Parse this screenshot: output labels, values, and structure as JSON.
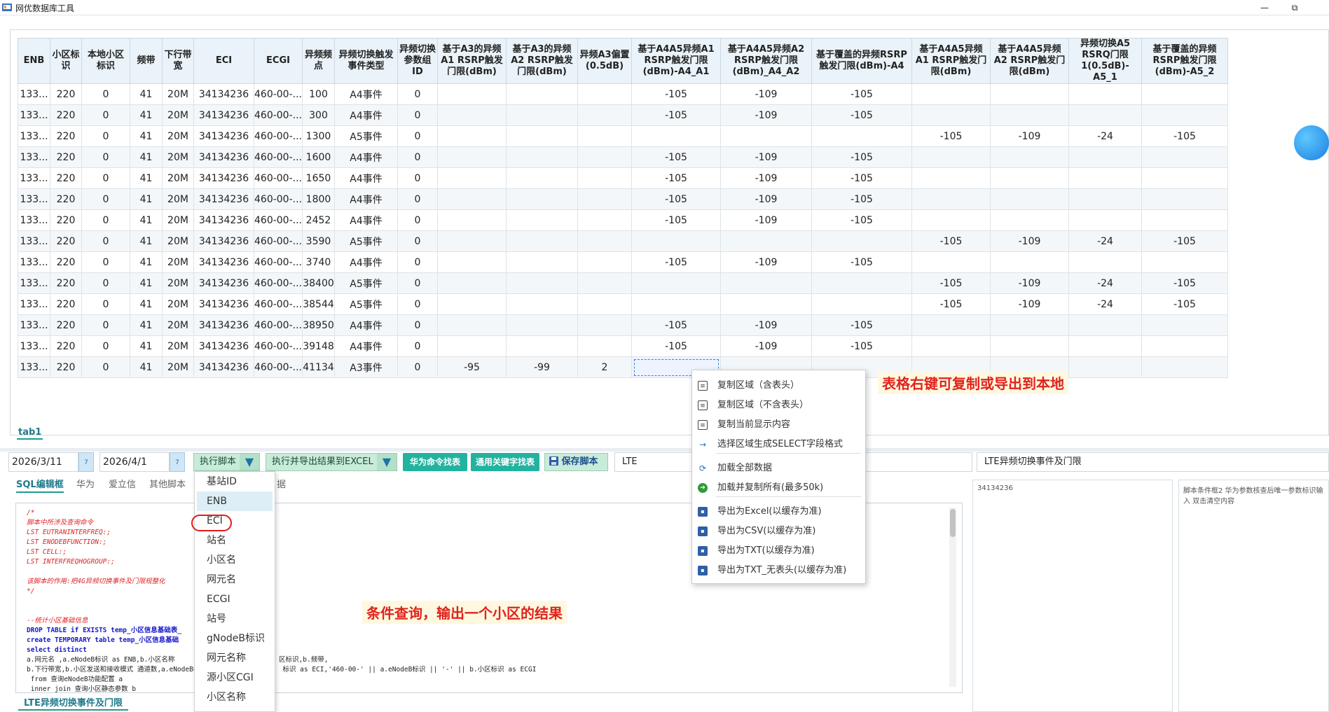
{
  "app": {
    "title": "网优数据库工具",
    "min_glyph": "—",
    "restore_glyph": "⧉"
  },
  "grid": {
    "headers": [
      "ENB",
      "小区标识",
      "本地小区标识",
      "频带",
      "下行带宽",
      "ECI",
      "ECGI",
      "异频频点",
      "异频切换触发事件类型",
      "异频切换参数组ID",
      "基于A3的异频A1 RSRP触发门限(dBm)",
      "基于A3的异频A2 RSRP触发门限(dBm)",
      "异频A3偏置(0.5dB)",
      "基于A4A5异频A1 RSRP触发门限(dBm)-A4_A1",
      "基于A4A5异频A2 RSRP触发门限(dBm)_A4_A2",
      "基于覆盖的异频RSRP触发门限(dBm)-A4",
      "基于A4A5异频A1 RSRP触发门限(dBm)",
      "基于A4A5异频A2 RSRP触发门限(dBm)",
      "异频切换A5 RSRQ门限1(0.5dB)-A5_1",
      "基于覆盖的异频RSRP触发门限(dBm)-A5_2"
    ],
    "rows": [
      [
        "133...",
        "220",
        "0",
        "41",
        "20M",
        "34134236",
        "460-00-...",
        "100",
        "A4事件",
        "0",
        "",
        "",
        "",
        "-105",
        "-109",
        "-105",
        "",
        "",
        "",
        ""
      ],
      [
        "133...",
        "220",
        "0",
        "41",
        "20M",
        "34134236",
        "460-00-...",
        "300",
        "A4事件",
        "0",
        "",
        "",
        "",
        "-105",
        "-109",
        "-105",
        "",
        "",
        "",
        ""
      ],
      [
        "133...",
        "220",
        "0",
        "41",
        "20M",
        "34134236",
        "460-00-...",
        "1300",
        "A5事件",
        "0",
        "",
        "",
        "",
        "",
        "",
        "",
        "-105",
        "-109",
        "-24",
        "-105"
      ],
      [
        "133...",
        "220",
        "0",
        "41",
        "20M",
        "34134236",
        "460-00-...",
        "1600",
        "A4事件",
        "0",
        "",
        "",
        "",
        "-105",
        "-109",
        "-105",
        "",
        "",
        "",
        ""
      ],
      [
        "133...",
        "220",
        "0",
        "41",
        "20M",
        "34134236",
        "460-00-...",
        "1650",
        "A4事件",
        "0",
        "",
        "",
        "",
        "-105",
        "-109",
        "-105",
        "",
        "",
        "",
        ""
      ],
      [
        "133...",
        "220",
        "0",
        "41",
        "20M",
        "34134236",
        "460-00-...",
        "1800",
        "A4事件",
        "0",
        "",
        "",
        "",
        "-105",
        "-109",
        "-105",
        "",
        "",
        "",
        ""
      ],
      [
        "133...",
        "220",
        "0",
        "41",
        "20M",
        "34134236",
        "460-00-...",
        "2452",
        "A4事件",
        "0",
        "",
        "",
        "",
        "-105",
        "-109",
        "-105",
        "",
        "",
        "",
        ""
      ],
      [
        "133...",
        "220",
        "0",
        "41",
        "20M",
        "34134236",
        "460-00-...",
        "3590",
        "A5事件",
        "0",
        "",
        "",
        "",
        "",
        "",
        "",
        "-105",
        "-109",
        "-24",
        "-105"
      ],
      [
        "133...",
        "220",
        "0",
        "41",
        "20M",
        "34134236",
        "460-00-...",
        "3740",
        "A4事件",
        "0",
        "",
        "",
        "",
        "-105",
        "-109",
        "-105",
        "",
        "",
        "",
        ""
      ],
      [
        "133...",
        "220",
        "0",
        "41",
        "20M",
        "34134236",
        "460-00-...",
        "38400",
        "A5事件",
        "0",
        "",
        "",
        "",
        "",
        "",
        "",
        "-105",
        "-109",
        "-24",
        "-105"
      ],
      [
        "133...",
        "220",
        "0",
        "41",
        "20M",
        "34134236",
        "460-00-...",
        "38544",
        "A5事件",
        "0",
        "",
        "",
        "",
        "",
        "",
        "",
        "-105",
        "-109",
        "-24",
        "-105"
      ],
      [
        "133...",
        "220",
        "0",
        "41",
        "20M",
        "34134236",
        "460-00-...",
        "38950",
        "A4事件",
        "0",
        "",
        "",
        "",
        "-105",
        "-109",
        "-105",
        "",
        "",
        "",
        ""
      ],
      [
        "133...",
        "220",
        "0",
        "41",
        "20M",
        "34134236",
        "460-00-...",
        "39148",
        "A4事件",
        "0",
        "",
        "",
        "",
        "-105",
        "-109",
        "-105",
        "",
        "",
        "",
        ""
      ],
      [
        "133...",
        "220",
        "0",
        "41",
        "20M",
        "34134236",
        "460-00-...",
        "41134",
        "A3事件",
        "0",
        "-95",
        "-99",
        "2",
        "",
        "",
        "",
        "",
        "",
        "",
        ""
      ]
    ],
    "tab_label": "tab1"
  },
  "annotations": {
    "right_click": "表格右键可复制或导出到本地",
    "condition_query": "条件查询，输出一个小区的结果"
  },
  "toolbar": {
    "date_from": "2026/3/11",
    "date_to": "2026/4/1",
    "calendar_glyph": "7",
    "run_script": "执行脚本",
    "run_export": "执行并导出结果到EXCEL",
    "huawei_cmd": "华为命令找表",
    "keyword_find": "通用关键字找表",
    "save_script": "保存脚本",
    "search_value": "LTE",
    "script_name": "LTE异频切换事件及门限",
    "dropdown_arrow": "▼"
  },
  "editor_tabs": [
    "SQL编辑框",
    "华为",
    "爱立信",
    "其他脚本"
  ],
  "editor_tab_tail": "据",
  "editor": {
    "lines": [
      {
        "t": "/*",
        "s": "red"
      },
      {
        "t": "脚本中所涉及查询命令",
        "s": "red"
      },
      {
        "t": "LST EUTRANINTERFREQ:;",
        "s": "red"
      },
      {
        "t": "LST ENODEBFUNCTION:;",
        "s": "red"
      },
      {
        "t": "LST CELL:;",
        "s": "red"
      },
      {
        "t": "LST INTERFREQHOGROUP:;",
        "s": "red"
      },
      {
        "t": "",
        "s": ""
      },
      {
        "t": "该脚本的作用:把4G异频切换事件及门限规整化",
        "s": "red"
      },
      {
        "t": "*/",
        "s": "red"
      },
      {
        "t": "",
        "s": ""
      },
      {
        "t": "",
        "s": ""
      },
      {
        "t": "--统计小区基础信息",
        "s": "red"
      },
      {
        "t": "DROP TABLE if EXISTS temp_小区信息基础表_",
        "s": "mix"
      },
      {
        "t": "create TEMPORARY table temp_小区信息基础",
        "s": "mix"
      },
      {
        "t": "select distinct",
        "s": "blue"
      },
      {
        "t": "a.网元名 ,a.eNodeB标识 as ENB,b.小区名称                          区标识,b.频带,",
        "s": ""
      },
      {
        "t": "b.下行带宽,b.小区发送和接收模式 通道数,a.eNodeB标识 *                 标识 as ECI,'460-00-' || a.eNodeB标识 || '-' || b.小区标识 as ECGI",
        "s": ""
      },
      {
        "t": " from 查询eNodeB功能配置 a",
        "s": ""
      },
      {
        "t": " inner join 查询小区静态参数 b",
        "s": ""
      }
    ],
    "vscroll_glyph": ""
  },
  "side": {
    "eci_value": "34134236",
    "hint": "脚本条件框2  华为参数核查后唯一参数标识输入   双击清空内容"
  },
  "bottom_tab": "LTE异频切换事件及门限",
  "dropdown_items": [
    "基站ID",
    "ENB",
    "ECI",
    "站名",
    "小区名",
    "网元名",
    "ECGI",
    "站号",
    "gNodeB标识",
    "网元名称",
    "源小区CGI",
    "小区名称"
  ],
  "context_menu": [
    {
      "label": "复制区域（含表头）",
      "icon": "doc-icon",
      "glyph": "≡"
    },
    {
      "label": "复制区域（不含表头）",
      "icon": "doc-icon",
      "glyph": "≡"
    },
    {
      "label": "复制当前显示内容",
      "icon": "doc-icon",
      "glyph": "≡"
    },
    {
      "label": "选择区域生成SELECT字段格式",
      "icon": "arrow-right-icon",
      "glyph": "→"
    },
    {
      "label": "加载全部数据",
      "icon": "refresh-icon",
      "glyph": "⟳"
    },
    {
      "label": "加载并复制所有(最多50k)",
      "icon": "go-icon",
      "glyph": "➜"
    },
    {
      "label": "导出为Excel(以缓存为准)",
      "icon": "disk-icon",
      "glyph": "▪"
    },
    {
      "label": "导出为CSV(以缓存为准)",
      "icon": "disk-icon",
      "glyph": "▪"
    },
    {
      "label": "导出为TXT(以缓存为准)",
      "icon": "disk-icon",
      "glyph": "▪"
    },
    {
      "label": "导出为TXT_无表头(以缓存为准)",
      "icon": "disk-icon",
      "glyph": "▪"
    }
  ],
  "colors": {
    "accent": "#22b3a0",
    "annotation_red": "#e0231c",
    "header_bg": "#eaf3f9"
  }
}
